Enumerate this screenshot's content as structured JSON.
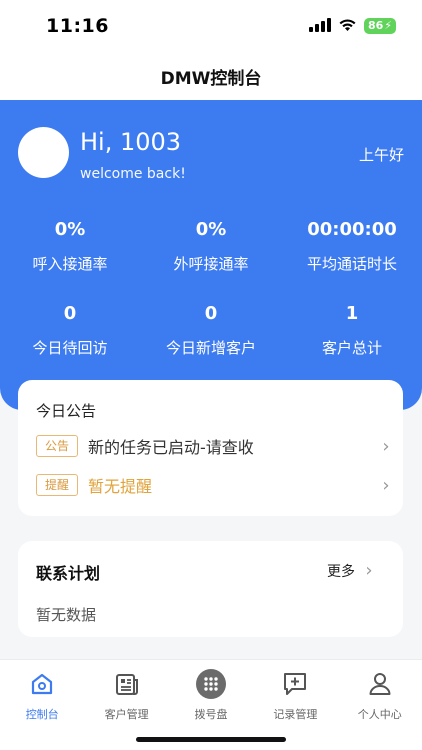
{
  "status_bar": {
    "time": "11:16",
    "battery": "86"
  },
  "nav": {
    "title": "DMW控制台"
  },
  "hero": {
    "greeting": "Hi, 1003",
    "welcome": "welcome back!",
    "time_greeting": "上午好",
    "stats": [
      {
        "value": "0%",
        "label": "呼入接通率"
      },
      {
        "value": "0%",
        "label": "外呼接通率"
      },
      {
        "value": "00:00:00",
        "label": "平均通话时长"
      },
      {
        "value": "0",
        "label": "今日待回访"
      },
      {
        "value": "0",
        "label": "今日新增客户"
      },
      {
        "value": "1",
        "label": "客户总计"
      }
    ]
  },
  "notice": {
    "title": "今日公告",
    "items": [
      {
        "tag": "公告",
        "text": "新的任务已启动-请查收"
      },
      {
        "tag": "提醒",
        "text": "暂无提醒"
      }
    ]
  },
  "plan": {
    "title": "联系计划",
    "more": "更多",
    "empty": "暂无数据"
  },
  "tabs": [
    {
      "label": "控制台",
      "icon": "home-icon"
    },
    {
      "label": "客户管理",
      "icon": "customer-icon"
    },
    {
      "label": "拨号盘",
      "icon": "dialpad-icon"
    },
    {
      "label": "记录管理",
      "icon": "record-add-icon"
    },
    {
      "label": "个人中心",
      "icon": "person-icon"
    }
  ],
  "colors": {
    "primary": "#3d7bf0",
    "tag": "#e1a33b",
    "battery": "#5fd35a"
  }
}
